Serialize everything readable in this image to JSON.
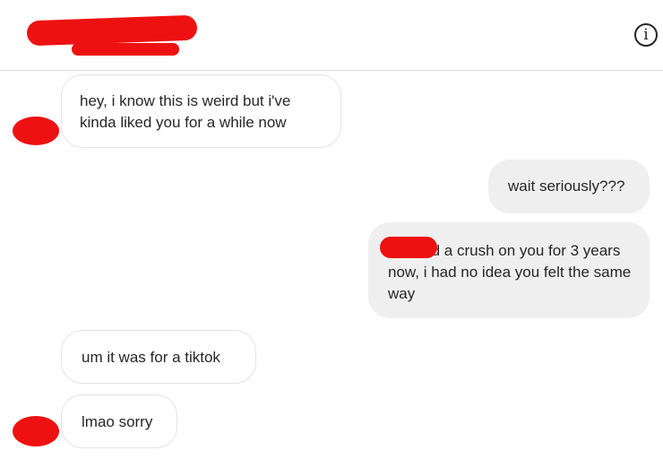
{
  "header": {
    "info_icon": "info-icon",
    "info_glyph": "i"
  },
  "messages": [
    {
      "sender": "them",
      "text": "hey, i know this is weird but i've kinda liked you for a while now"
    },
    {
      "sender": "me",
      "text": "wait seriously???"
    },
    {
      "sender": "me",
      "text": "i've had a crush on you for 3 years now, i had no idea you felt the same way"
    },
    {
      "sender": "them",
      "text": "um it was for a tiktok"
    },
    {
      "sender": "them",
      "text": "lmao sorry"
    }
  ],
  "colors": {
    "redaction": "#ee1111",
    "outgoing_bubble": "#efefef",
    "incoming_border": "#e3e3e3",
    "divider": "#dbdbdb"
  }
}
